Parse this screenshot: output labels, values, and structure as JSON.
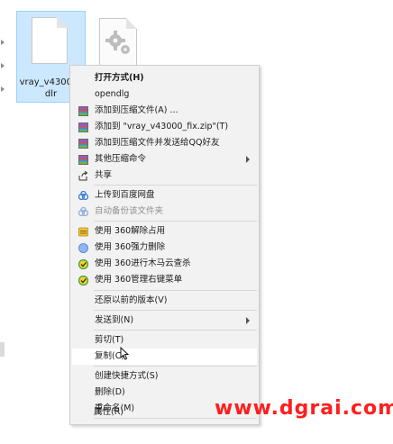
{
  "desktop": {
    "selected_file": {
      "name": "vray_v43000_dlr",
      "icon": "blank-file-icon"
    },
    "second_file": {
      "icon": "settings-file-icon"
    }
  },
  "context_menu": {
    "items": [
      {
        "label": "打开方式(H)",
        "style": "bold",
        "icon": ""
      },
      {
        "label": "opendlg",
        "icon": ""
      },
      {
        "label": "添加到压缩文件(A) ...",
        "icon": "winrar-icon"
      },
      {
        "label": "添加到 \"vray_v43000_fix.zip\"(T)",
        "icon": "winrar-icon"
      },
      {
        "label": "添加到压缩文件并发送给QQ好友",
        "icon": "winrar-icon"
      },
      {
        "label": "其他压缩命令",
        "icon": "winrar-icon",
        "submenu": true
      },
      {
        "label": "共享",
        "icon": "share-icon"
      },
      {
        "label": "上传到百度网盘",
        "icon": "baidu-netdisk-icon"
      },
      {
        "label": "自动备份该文件夹",
        "icon": "baidu-netdisk-icon",
        "disabled": true
      },
      {
        "label": "使用 360解除占用",
        "icon": "unlock-360-icon"
      },
      {
        "label": "使用 360强力删除",
        "icon": "delete-360-icon"
      },
      {
        "label": "使用 360进行木马云查杀",
        "icon": "scan-360-icon"
      },
      {
        "label": "使用 360管理右键菜单",
        "icon": "menu-360-icon"
      },
      {
        "label": "还原以前的版本(V)",
        "icon": ""
      },
      {
        "label": "发送到(N)",
        "icon": "",
        "submenu": true
      },
      {
        "label": "剪切(T)",
        "icon": ""
      },
      {
        "label": "复制(C)",
        "icon": "",
        "hovered": true
      },
      {
        "label": "创建快捷方式(S)",
        "icon": ""
      },
      {
        "label": "删除(D)",
        "icon": ""
      },
      {
        "label": "重命名(M)",
        "icon": ""
      },
      {
        "label": "属性(R)",
        "icon": ""
      }
    ]
  },
  "watermark": {
    "text": "www.dgrai.com",
    "color": "#ff1e1e"
  },
  "colors": {
    "selection": "#cce8ff",
    "menu_bg": "#f2f2f2",
    "hover": "#ffffff"
  }
}
